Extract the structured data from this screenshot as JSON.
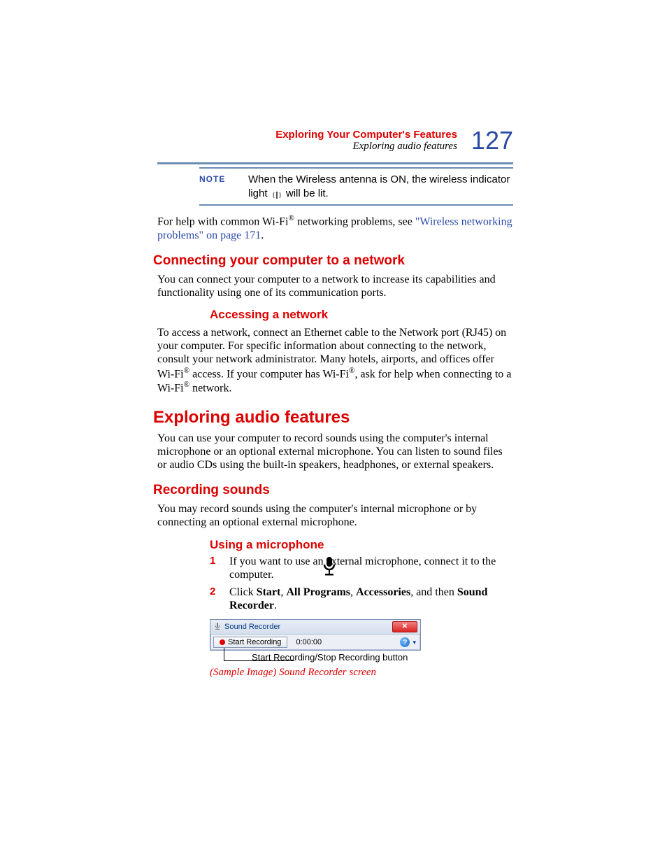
{
  "header": {
    "chapter": "Exploring Your Computer's Features",
    "section": "Exploring audio features",
    "page": "127"
  },
  "note": {
    "label": "NOTE",
    "text_before": "When the Wireless antenna is ON, the wireless indicator light ",
    "text_after": " will be lit."
  },
  "para1_a": "For help with common Wi-Fi",
  "para1_b": " networking problems, see ",
  "link1": "\"Wireless networking problems\" on page 171",
  "h2_connecting": "Connecting your computer to a network",
  "para2": "You can connect your computer to a network to increase its capabilities and functionality using one of its communication ports.",
  "h3_accessing": "Accessing a network",
  "para3_a": "To access a network, connect an Ethernet cable to the Network port (RJ45) on your computer. For specific information about connecting to the network, consult your network administrator. Many hotels, airports, and offices offer Wi-Fi",
  "para3_b": " access. If your computer has Wi-Fi",
  "para3_c": ", ask for help when connecting to a Wi-Fi",
  "para3_d": " network.",
  "h1_audio": "Exploring audio features",
  "para4": "You can use your computer to record sounds using the computer's internal microphone or an optional external microphone. You can listen to sound files or audio CDs using the built-in speakers, headphones, or external speakers.",
  "h2_recording": "Recording sounds",
  "para5": "You may record sounds using the computer's internal microphone or by connecting an optional external microphone.",
  "h3_mic": "Using a microphone",
  "step1_num": "1",
  "step1": "If you want to use an external microphone, connect it to the computer.",
  "step2_num": "2",
  "step2_a": "Click ",
  "step2_b": "Start",
  "step2_c": ", ",
  "step2_d": "All Programs",
  "step2_e": ", ",
  "step2_f": "Accessories",
  "step2_g": ", and then ",
  "step2_h": "Sound Recorder",
  "step2_i": ".",
  "sound_recorder": {
    "title": "Sound Recorder",
    "start_label": "Start Recording",
    "time": "0:00:00"
  },
  "callout": "Start Recording/Stop Recording button",
  "caption": "(Sample Image) Sound Recorder screen",
  "reg": "®"
}
